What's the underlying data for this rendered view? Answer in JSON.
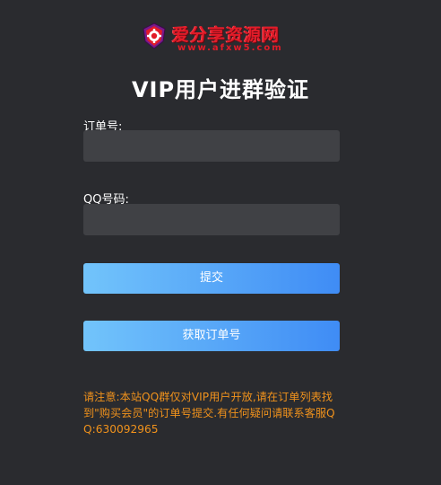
{
  "logo": {
    "title": "爱分享资源网",
    "domain": "www.afxw5.com",
    "icon": "shield-gear-icon",
    "color": "#e21b28"
  },
  "page_title": "VIP用户进群验证",
  "form": {
    "order_label": "订单号:",
    "order_value": "",
    "order_placeholder": "",
    "qq_label": "QQ号码:",
    "qq_value": "",
    "qq_placeholder": ""
  },
  "buttons": {
    "submit": "提交",
    "get_order": "获取订单号"
  },
  "notice": "请注意:本站QQ群仅对VIP用户开放,请在订单列表找到\"购买会员\"的订单号提交.有任何疑问请联系客服QQ:630092965",
  "colors": {
    "background": "#2a2b2f",
    "input_bg": "#404145",
    "button_start": "#72c4fb",
    "button_end": "#3f8cf5",
    "notice": "#f0921c"
  }
}
